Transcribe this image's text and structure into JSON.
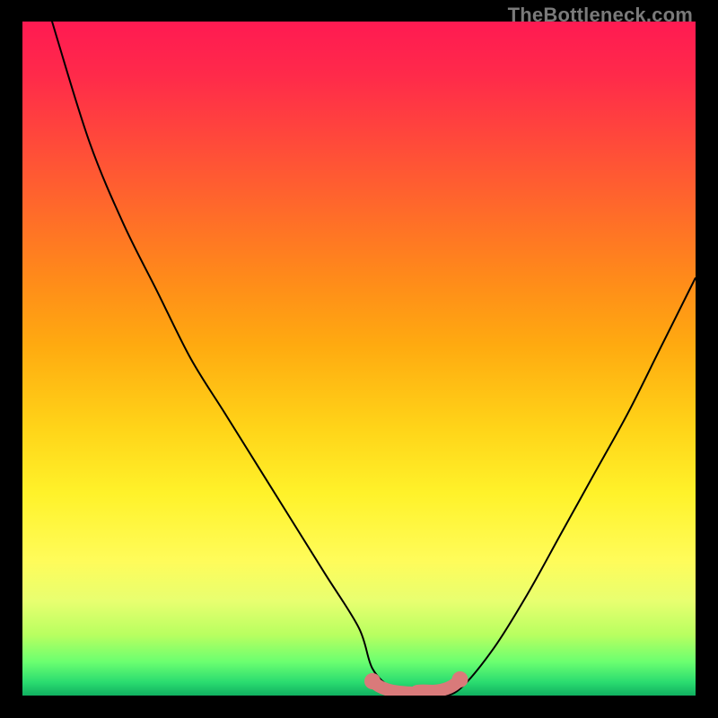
{
  "watermark": "TheBottleneck.com",
  "colors": {
    "page_bg": "#000000",
    "curve": "#000000",
    "highlight": "#d97a7a"
  },
  "chart_data": {
    "type": "line",
    "title": "",
    "xlabel": "",
    "ylabel": "",
    "xlim": [
      0,
      100
    ],
    "ylim": [
      0,
      100
    ],
    "grid": false,
    "legend": false,
    "note": "Percentage bottleneck curve; minimum region highlighted in pink.",
    "series": [
      {
        "name": "bottleneck-curve",
        "x": [
          0,
          5,
          10,
          15,
          20,
          25,
          30,
          35,
          40,
          45,
          50,
          52,
          55,
          58,
          62,
          65,
          70,
          75,
          80,
          85,
          90,
          95,
          100
        ],
        "y": [
          115,
          98,
          82,
          70,
          60,
          50,
          42,
          34,
          26,
          18,
          10,
          4,
          1,
          0,
          0,
          1,
          7,
          15,
          24,
          33,
          42,
          52,
          62
        ]
      }
    ],
    "highlight_region": {
      "name": "optimal-range",
      "x_start": 52,
      "x_end": 65,
      "y": 0
    }
  }
}
